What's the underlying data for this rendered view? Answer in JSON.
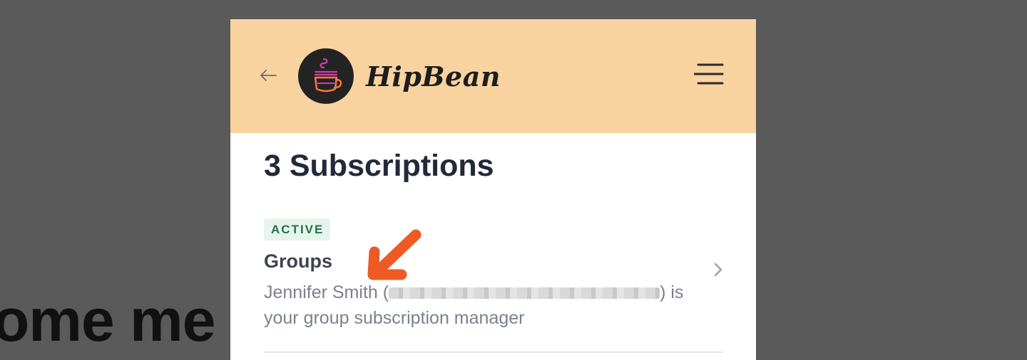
{
  "background": {
    "text": "ome me"
  },
  "header": {
    "brand": "HipBean",
    "back_icon": "arrow-left-icon",
    "menu_icon": "hamburger-menu-icon",
    "logo_icon": "coffee-cup-icon",
    "bg_color": "#f8d3a0"
  },
  "main": {
    "title": "3 Subscriptions",
    "subscription": {
      "status": "ACTIVE",
      "name": "Groups",
      "manager_prefix": "Jennifer Smith (",
      "manager_suffix": ") is your group subscription manager",
      "chevron_icon": "chevron-right-icon"
    }
  },
  "annotation": {
    "icon": "annotation-arrow-icon",
    "color": "#ee5a24"
  }
}
